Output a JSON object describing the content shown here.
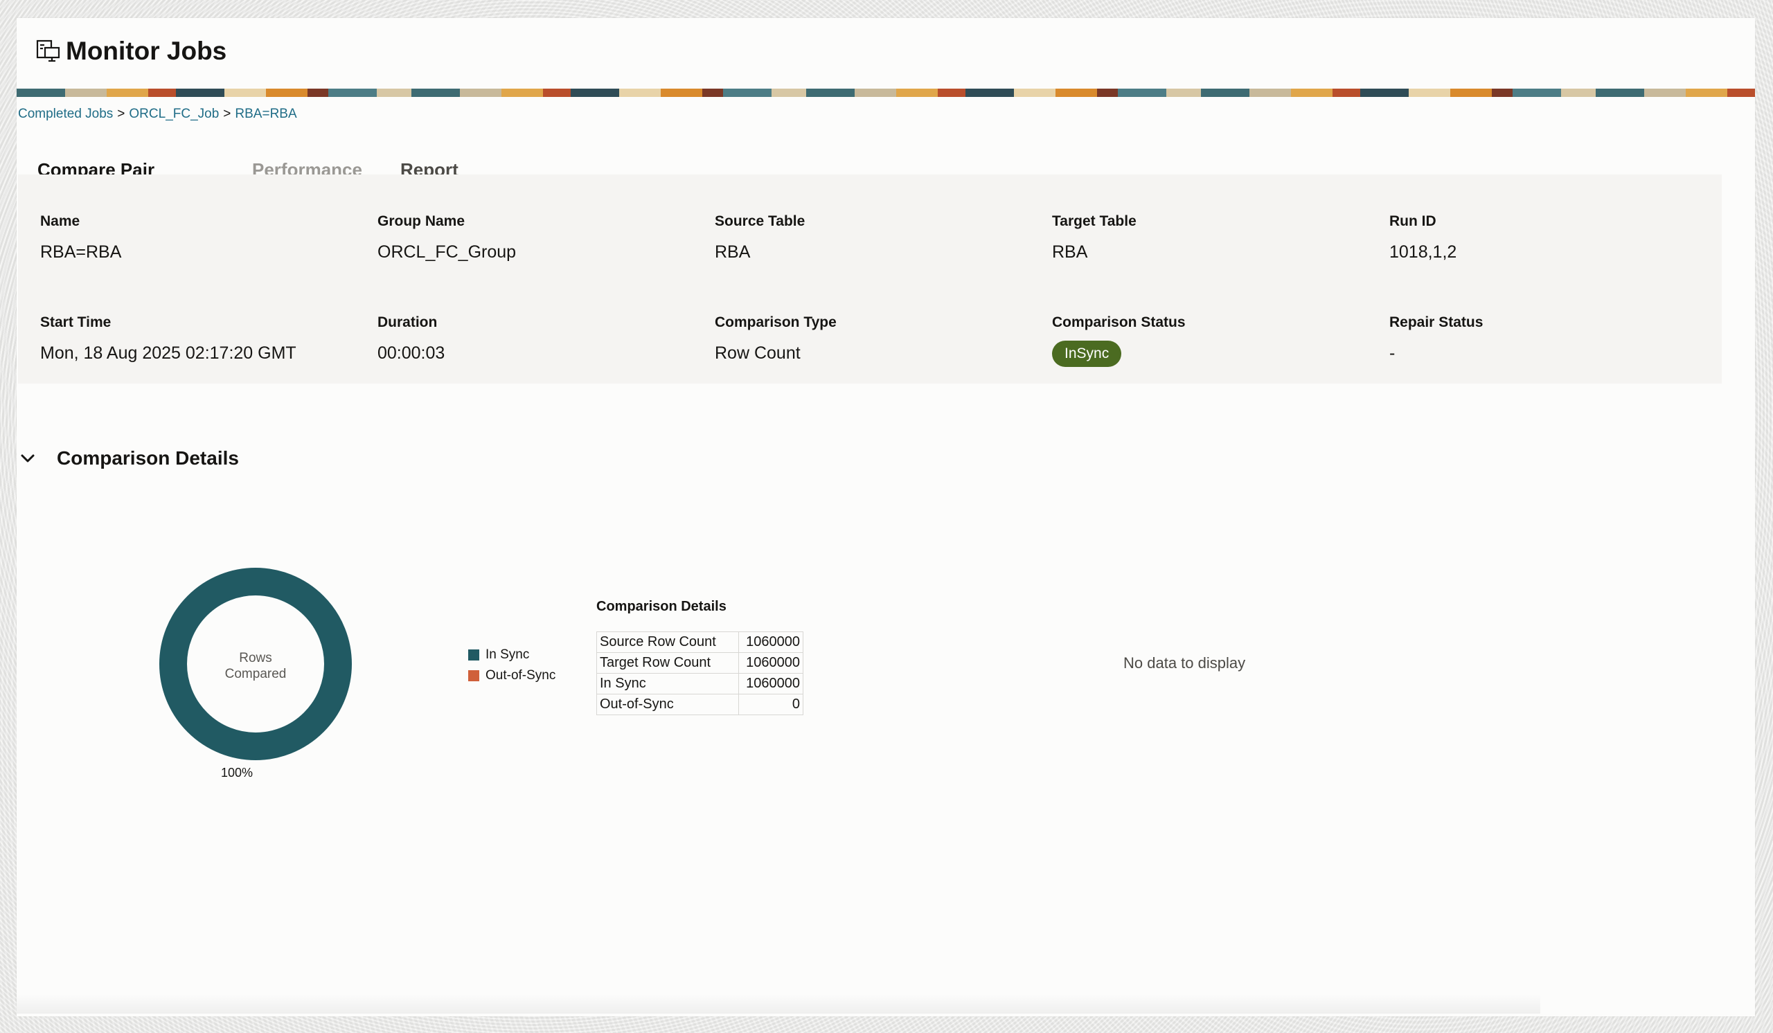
{
  "header": {
    "title": "Monitor Jobs",
    "icon": "monitor-jobs-icon"
  },
  "breadcrumb": {
    "items": [
      "Completed Jobs",
      "ORCL_FC_Job",
      "RBA=RBA"
    ],
    "separator": ">"
  },
  "tabs": [
    {
      "label": "Compare Pair Details",
      "state": "active"
    },
    {
      "label": "Performance",
      "state": "disabled"
    },
    {
      "label": "Report",
      "state": "normal"
    }
  ],
  "details": {
    "name": {
      "label": "Name",
      "value": "RBA=RBA"
    },
    "group_name": {
      "label": "Group Name",
      "value": "ORCL_FC_Group"
    },
    "source_table": {
      "label": "Source Table",
      "value": "RBA"
    },
    "target_table": {
      "label": "Target Table",
      "value": "RBA"
    },
    "run_id": {
      "label": "Run ID",
      "value": "1018,1,2"
    },
    "start_time": {
      "label": "Start Time",
      "value": "Mon, 18 Aug 2025 02:17:20 GMT"
    },
    "duration": {
      "label": "Duration",
      "value": "00:00:03"
    },
    "comparison_type": {
      "label": "Comparison Type",
      "value": "Row Count"
    },
    "comparison_status": {
      "label": "Comparison Status",
      "value": "InSync",
      "color": "#4b6b21"
    },
    "repair_status": {
      "label": "Repair Status",
      "value": "-"
    }
  },
  "comparison_section": {
    "title": "Comparison Details",
    "expanded": true,
    "donut": {
      "center_line1": "Rows",
      "center_line2": "Compared",
      "percent_label": "100%",
      "in_sync_fraction": 1.0
    },
    "legend": [
      {
        "label": "In Sync",
        "color": "#215a63"
      },
      {
        "label": "Out-of-Sync",
        "color": "#d0603a"
      }
    ],
    "table_title": "Comparison Details",
    "table": [
      {
        "key": "Source Row Count",
        "value": "1060000"
      },
      {
        "key": "Target Row Count",
        "value": "1060000"
      },
      {
        "key": "In Sync",
        "value": "1060000"
      },
      {
        "key": "Out-of-Sync",
        "value": "0"
      }
    ],
    "no_data": "No data to display"
  }
}
